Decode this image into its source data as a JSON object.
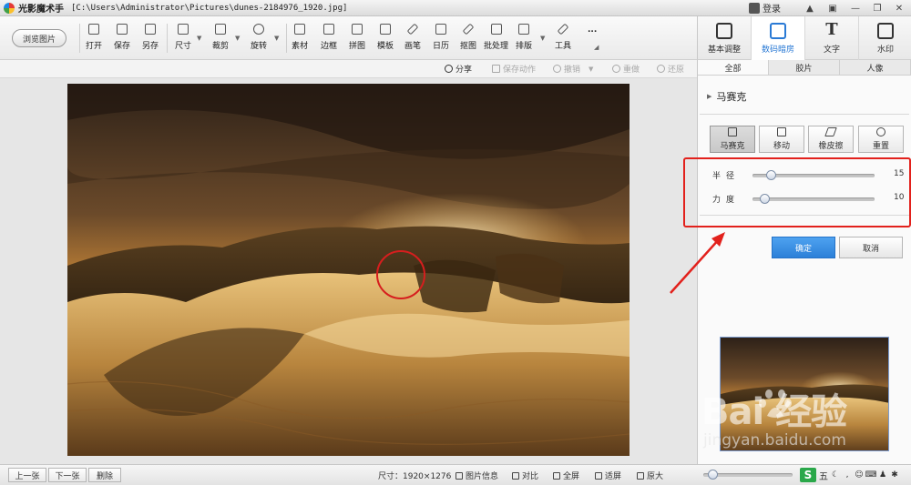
{
  "window": {
    "app_name": "光影魔术手",
    "file_path": "[C:\\Users\\Administrator\\Pictures\\dunes-2184976_1920.jpg]",
    "login_label": "登录",
    "controls": [
      "minimize-icon",
      "maximize-icon",
      "close-icon"
    ]
  },
  "toolbar": {
    "browse_label": "浏览图片",
    "items": [
      {
        "label": "打开",
        "icon": "folder-open-icon"
      },
      {
        "label": "保存",
        "icon": "save-icon"
      },
      {
        "label": "另存",
        "icon": "save-as-icon"
      },
      {
        "label": "尺寸",
        "icon": "resize-icon"
      },
      {
        "label": "裁剪",
        "icon": "crop-icon"
      },
      {
        "label": "旋转",
        "icon": "rotate-icon"
      },
      {
        "label": "素材",
        "icon": "material-icon"
      },
      {
        "label": "边框",
        "icon": "border-icon"
      },
      {
        "label": "拼图",
        "icon": "collage-icon"
      },
      {
        "label": "模板",
        "icon": "template-icon"
      },
      {
        "label": "画笔",
        "icon": "brush-icon"
      },
      {
        "label": "日历",
        "icon": "calendar-icon"
      },
      {
        "label": "抠图",
        "icon": "cutout-icon"
      },
      {
        "label": "批处理",
        "icon": "batch-icon"
      },
      {
        "label": "排版",
        "icon": "layout-icon"
      },
      {
        "label": "工具",
        "icon": "wrench-icon"
      },
      {
        "label": "...",
        "icon": "more-icon"
      }
    ]
  },
  "panel_tabs": [
    {
      "label": "基本调整",
      "icon": "adjust-icon",
      "active": false
    },
    {
      "label": "数码暗房",
      "icon": "darkroom-icon",
      "active": true
    },
    {
      "label": "文字",
      "icon": "text-icon",
      "active": false
    },
    {
      "label": "水印",
      "icon": "watermark-icon",
      "active": false
    }
  ],
  "subtoolbar": {
    "share": "分享",
    "save_action": "保存动作",
    "undo": "撤销",
    "redo": "重做",
    "restore": "还原"
  },
  "right_panel": {
    "tabs": [
      {
        "label": "全部",
        "active": true
      },
      {
        "label": "胶片",
        "active": false
      },
      {
        "label": "人像",
        "active": false
      }
    ],
    "section_title": "马赛克",
    "mode_buttons": [
      {
        "label": "马赛克",
        "icon": "mosaic-icon",
        "active": true
      },
      {
        "label": "移动",
        "icon": "move-icon",
        "active": false
      },
      {
        "label": "橡皮擦",
        "icon": "eraser-icon",
        "active": false
      },
      {
        "label": "重置",
        "icon": "reset-arrow-icon",
        "active": false
      }
    ],
    "sliders": [
      {
        "label": "半径",
        "value": 15,
        "min": 0,
        "max": 100
      },
      {
        "label": "力度",
        "value": 10,
        "min": 0,
        "max": 100
      }
    ],
    "confirm_label": "确定",
    "cancel_label": "取消"
  },
  "statusbar": {
    "prev": "上一张",
    "next": "下一张",
    "delete": "删除",
    "size_text": "尺寸：1920×1276",
    "info": "图片信息",
    "compare": "对比",
    "fullscreen": "全屏",
    "fit": "适屏",
    "original": "原大",
    "zoom_fraction": 0.1,
    "ime_label": "五"
  },
  "watermark": {
    "main": "Bai  经验",
    "sub": "jingyan.baidu.com"
  },
  "colors": {
    "accent_blue": "#2a7ad5",
    "annotation_red": "#e2211c",
    "confirm_blue": "#3a8ee6"
  }
}
